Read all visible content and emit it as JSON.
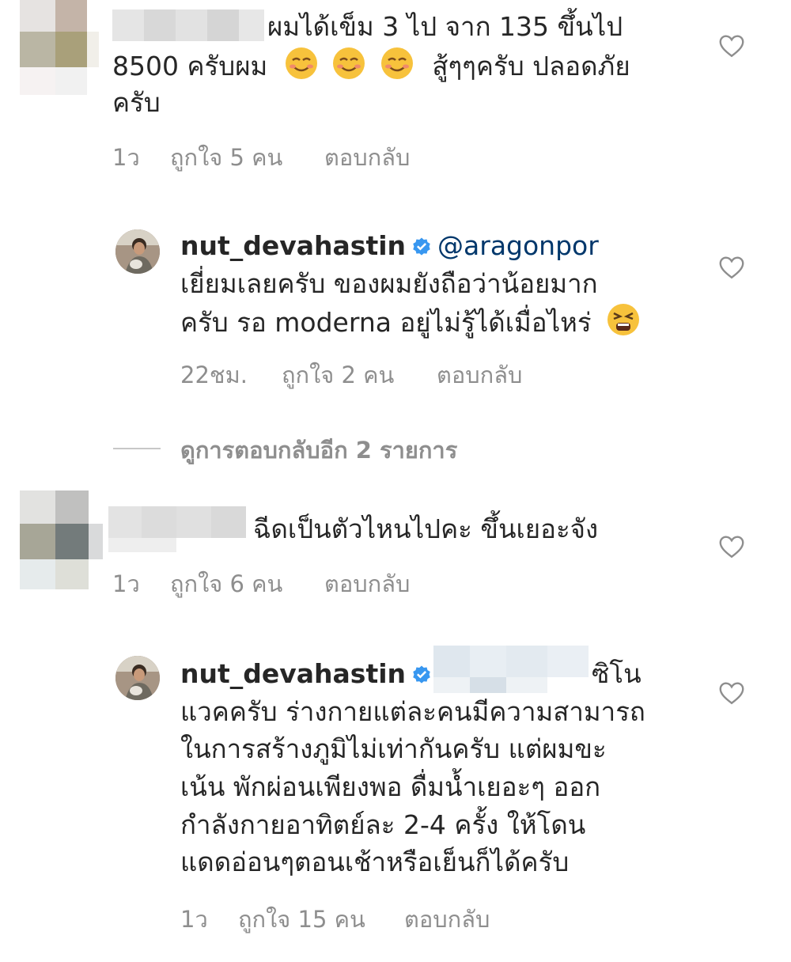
{
  "comments": [
    {
      "text_line1": "ผมได้เข็ม 3 ไป จาก 135 ขึ้นไป",
      "text_line2_a": "8500 ครับผม",
      "text_line2_b": "สู้ๆๆครับ ปลอดภัย",
      "text_line3": "ครับ",
      "time": "1ว",
      "likes": "ถูกใจ 5 คน",
      "reply": "ตอบกลับ"
    },
    {
      "username": "nut_devahastin",
      "mention": "@aragonpor",
      "text_line1": "เยี่ยมเลยครับ ของผมยังถือว่าน้อยมาก",
      "text_line2": "ครับ รอ moderna อยู่ไม่รู้ได้เมื่อไหร่",
      "time": "22ชม.",
      "likes": "ถูกใจ 2 คน",
      "reply": "ตอบกลับ"
    },
    {
      "view_more": "ดูการตอบกลับอีก 2 รายการ"
    },
    {
      "text_line1": "ฉีดเป็นตัวไหนไปคะ ขึ้นเยอะจัง",
      "time": "1ว",
      "likes": "ถูกใจ 6 คน",
      "reply": "ตอบกลับ"
    },
    {
      "username": "nut_devahastin",
      "mention_end": "ซิโน",
      "lines": [
        "แวคครับ ร่างกายแต่ละคนมีความสามารถ",
        "ในการสร้างภูมิไม่เท่ากันครับ แต่ผมขะ",
        "เน้น พักผ่อนเพียงพอ ดื่มน้ำเยอะๆ ออก",
        "กำลังกายอาทิตย์ละ 2-4 ครั้ง ให้โดน",
        "แดดอ่อนๆตอนเช้าหรือเย็นก็ได้ครับ"
      ],
      "time": "1ว",
      "likes": "ถูกใจ 15 คน",
      "reply": "ตอบกลับ"
    }
  ],
  "colors": {
    "text": "#262626",
    "meta": "#8e8e8e",
    "verified": "#3897f0",
    "mention": "#00376b"
  },
  "icons": [
    "heart-icon",
    "verified-badge-icon",
    "smiling-face-emoji",
    "tired-face-emoji"
  ]
}
